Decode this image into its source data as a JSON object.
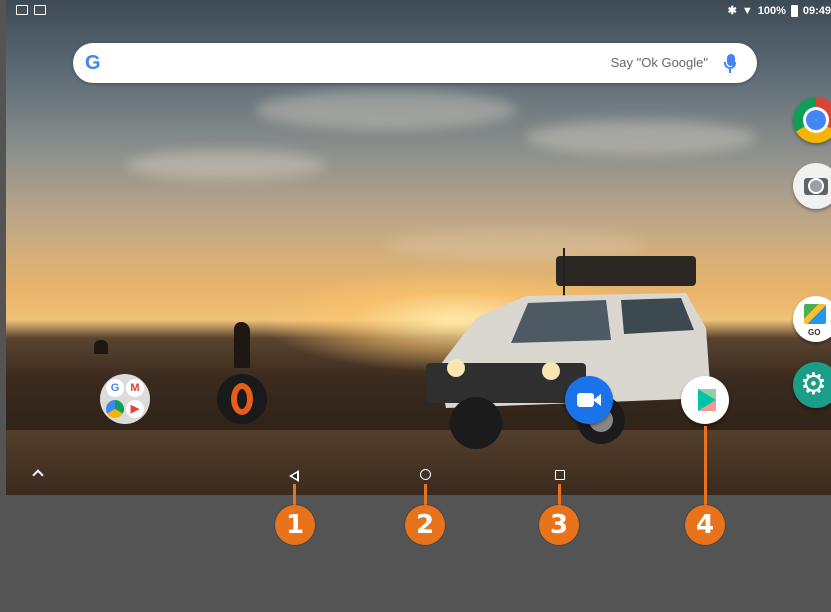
{
  "status_bar": {
    "battery": "100%",
    "time": "09:49",
    "icons": [
      "image-icon",
      "photo-icon",
      "bluetooth-icon",
      "wifi-icon",
      "battery-icon"
    ]
  },
  "search": {
    "logo": "G",
    "hint": "Say \"Ok Google\"",
    "mic_icon": "mic-icon"
  },
  "apps": {
    "dock_right": [
      "Chrome",
      "Camera",
      "Files Go",
      "Settings"
    ],
    "files_go_label": "GO",
    "home": [
      "Google folder",
      "Opera",
      "Duo",
      "Play Store"
    ]
  },
  "nav": {
    "buttons": [
      "back-icon",
      "home-icon",
      "recents-icon",
      "up-arrow-icon"
    ]
  },
  "callouts": [
    "1",
    "2",
    "3",
    "4"
  ],
  "colors": {
    "accent": "#e8731a",
    "google_blue": "#4285f4",
    "background_panel": "#545454"
  }
}
